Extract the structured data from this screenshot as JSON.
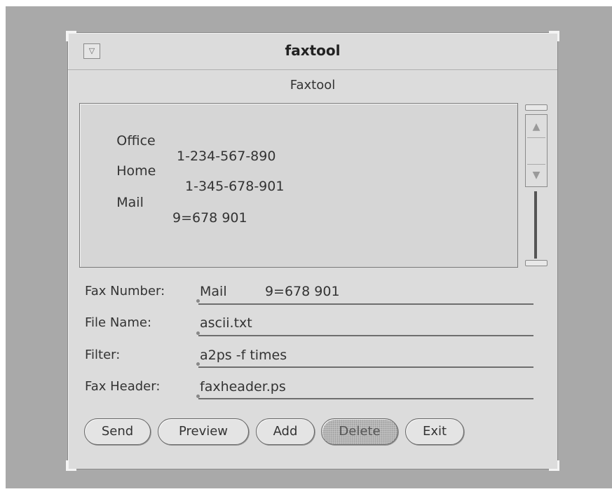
{
  "window": {
    "title": "faxtool",
    "menu_glyph": "▽",
    "panel_title": "Faxtool"
  },
  "list": {
    "items": [
      {
        "label": "Office",
        "number": "1-234-567-890"
      },
      {
        "label": "Home",
        "number": "1-345-678-901"
      },
      {
        "label": "Mail",
        "number": "9=678 901"
      }
    ]
  },
  "scrollbar": {
    "up_glyph": "▲",
    "down_glyph": "▼"
  },
  "form": {
    "fax_number": {
      "label": "Fax Number:",
      "value": "Mail         9=678 901"
    },
    "file_name": {
      "label": "File Name:",
      "value": "ascii.txt"
    },
    "filter": {
      "label": "Filter:",
      "value": "a2ps -f times"
    },
    "fax_header": {
      "label": "Fax Header:",
      "value": "faxheader.ps"
    }
  },
  "buttons": {
    "send": "Send",
    "preview": "Preview",
    "add": "Add",
    "delete": "Delete",
    "exit": "Exit"
  },
  "colors": {
    "background": "#a9a9a9",
    "window": "#dcdcdc",
    "text": "#333333"
  }
}
